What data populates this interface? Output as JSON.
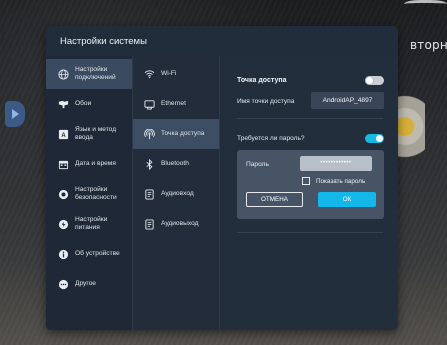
{
  "background": {
    "overlay_text": "вторн"
  },
  "dialog": {
    "title": "Настройки системы"
  },
  "menu": {
    "items": [
      {
        "label": "Настройки подключений",
        "icon": "globe-icon",
        "active": true
      },
      {
        "label": "Обои",
        "icon": "wallpaper-icon",
        "active": false
      },
      {
        "label": "Язык и метод ввода",
        "icon": "language-icon",
        "active": false
      },
      {
        "label": "Дата и время",
        "icon": "calendar-icon",
        "active": false
      },
      {
        "label": "Настройки безопасности",
        "icon": "security-icon",
        "active": false
      },
      {
        "label": "Настройки питания",
        "icon": "power-icon",
        "active": false
      },
      {
        "label": "Об устройстве",
        "icon": "info-icon",
        "active": false
      },
      {
        "label": "Другое",
        "icon": "more-icon",
        "active": false
      }
    ]
  },
  "submenu": {
    "items": [
      {
        "label": "Wi-Fi",
        "icon": "wifi-icon",
        "active": false
      },
      {
        "label": "Ethernet",
        "icon": "ethernet-icon",
        "active": false
      },
      {
        "label": "Точка доступа",
        "icon": "hotspot-icon",
        "active": true
      },
      {
        "label": "Bluetooth",
        "icon": "bluetooth-icon",
        "active": false
      },
      {
        "label": "Аудиовход",
        "icon": "audio-input-icon",
        "active": false
      },
      {
        "label": "Аудиовыход",
        "icon": "audio-output-icon",
        "active": false
      }
    ]
  },
  "hotspot": {
    "title": "Точка доступа",
    "enabled": false,
    "name_label": "Имя точки доступа",
    "name_value": "AndroidAP_4897",
    "password_required_label": "Требуется ли пароль?",
    "password_required": true,
    "password_label": "Пароль",
    "password_value": "••••••••••••",
    "show_password_label": "Показать пароль",
    "show_password_checked": false,
    "cancel_label": "ОТМЕНА",
    "ok_label": "ОК"
  },
  "colors": {
    "accent": "#14b7ea",
    "dialog_bg": "#222d3b",
    "active_row": "#3a4a60"
  }
}
